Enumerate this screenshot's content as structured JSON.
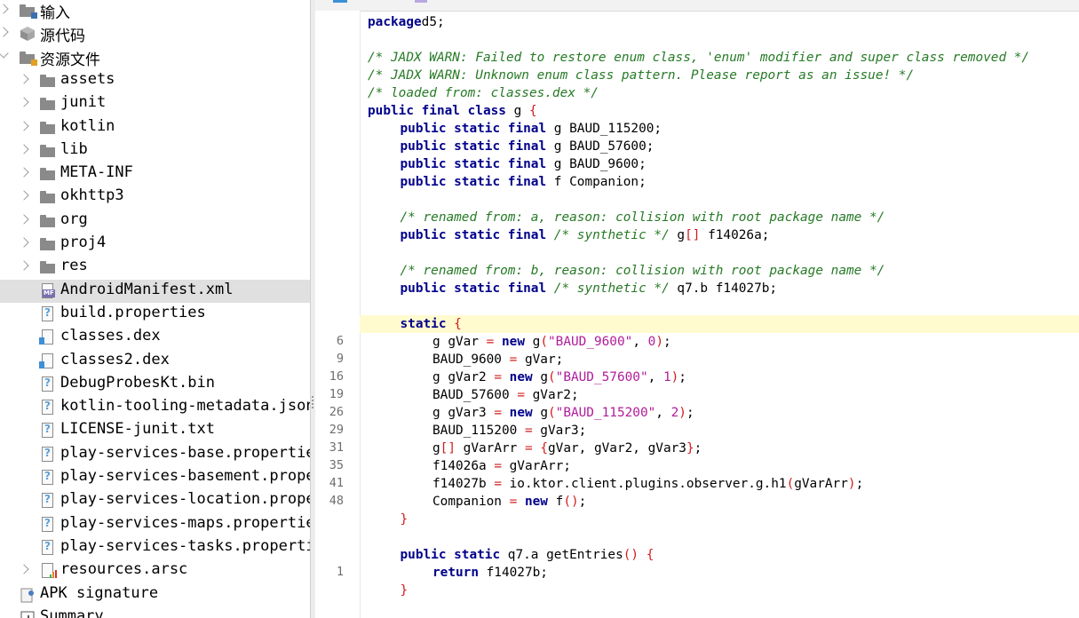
{
  "tree": {
    "items": [
      {
        "label": "输入",
        "icon": "input-icon",
        "chevron": "right",
        "indent": 0,
        "cjk": true
      },
      {
        "label": "源代码",
        "icon": "package-icon",
        "chevron": "right",
        "indent": 0,
        "cjk": true
      },
      {
        "label": "资源文件",
        "icon": "resources-folder-icon",
        "chevron": "down",
        "indent": 0,
        "cjk": true
      },
      {
        "label": "assets",
        "icon": "folder-icon",
        "chevron": "right",
        "indent": 1
      },
      {
        "label": "junit",
        "icon": "folder-icon",
        "chevron": "right",
        "indent": 1
      },
      {
        "label": "kotlin",
        "icon": "folder-icon",
        "chevron": "right",
        "indent": 1
      },
      {
        "label": "lib",
        "icon": "folder-icon",
        "chevron": "right",
        "indent": 1
      },
      {
        "label": "META-INF",
        "icon": "folder-icon",
        "chevron": "right",
        "indent": 1
      },
      {
        "label": "okhttp3",
        "icon": "folder-icon",
        "chevron": "right",
        "indent": 1
      },
      {
        "label": "org",
        "icon": "folder-icon",
        "chevron": "right",
        "indent": 1
      },
      {
        "label": "proj4",
        "icon": "folder-icon",
        "chevron": "right",
        "indent": 1
      },
      {
        "label": "res",
        "icon": "folder-icon",
        "chevron": "right",
        "indent": 1
      },
      {
        "label": "AndroidManifest.xml",
        "icon": "manifest-file-icon",
        "chevron": "",
        "indent": 1,
        "selected": true
      },
      {
        "label": "build.properties",
        "icon": "unknown-file-icon",
        "chevron": "",
        "indent": 1
      },
      {
        "label": "classes.dex",
        "icon": "dex-file-icon",
        "chevron": "",
        "indent": 1
      },
      {
        "label": "classes2.dex",
        "icon": "dex-file-icon",
        "chevron": "",
        "indent": 1
      },
      {
        "label": "DebugProbesKt.bin",
        "icon": "unknown-file-icon",
        "chevron": "",
        "indent": 1
      },
      {
        "label": "kotlin-tooling-metadata.json",
        "icon": "unknown-file-icon",
        "chevron": "",
        "indent": 1
      },
      {
        "label": "LICENSE-junit.txt",
        "icon": "unknown-file-icon",
        "chevron": "",
        "indent": 1
      },
      {
        "label": "play-services-base.properties",
        "icon": "unknown-file-icon",
        "chevron": "",
        "indent": 1
      },
      {
        "label": "play-services-basement.properties",
        "icon": "unknown-file-icon",
        "chevron": "",
        "indent": 1
      },
      {
        "label": "play-services-location.properties",
        "icon": "unknown-file-icon",
        "chevron": "",
        "indent": 1
      },
      {
        "label": "play-services-maps.properties",
        "icon": "unknown-file-icon",
        "chevron": "",
        "indent": 1
      },
      {
        "label": "play-services-tasks.properties",
        "icon": "unknown-file-icon",
        "chevron": "",
        "indent": 1
      },
      {
        "label": "resources.arsc",
        "icon": "arsc-file-icon",
        "chevron": "right",
        "indent": 1
      },
      {
        "label": "APK signature",
        "icon": "signature-icon",
        "chevron": "",
        "indent": 0
      },
      {
        "label": "Summary",
        "icon": "summary-icon",
        "chevron": "",
        "indent": 0
      }
    ]
  },
  "editor": {
    "highlight_line_index": 17,
    "lines": [
      {
        "ln": "",
        "ind": 0,
        "tokens": [
          [
            "kw",
            "package"
          ],
          [
            "",
            "d5;"
          ]
        ]
      },
      {
        "ln": "",
        "ind": 0,
        "tokens": []
      },
      {
        "ln": "",
        "ind": 0,
        "tokens": [
          [
            "cm",
            "/* JADX WARN: Failed to restore enum class, 'enum' modifier and super class removed */"
          ]
        ]
      },
      {
        "ln": "",
        "ind": 0,
        "tokens": [
          [
            "cm",
            "/* JADX WARN: Unknown enum class pattern. Please report as an issue! */"
          ]
        ]
      },
      {
        "ln": "",
        "ind": 0,
        "tokens": [
          [
            "cm",
            "/* loaded from: classes.dex */"
          ]
        ]
      },
      {
        "ln": "",
        "ind": 0,
        "tokens": [
          [
            "kw",
            "public final class"
          ],
          [
            "",
            " g "
          ],
          [
            "br",
            "{"
          ]
        ]
      },
      {
        "ln": "",
        "ind": 1,
        "tokens": [
          [
            "kw",
            "public static final"
          ],
          [
            "",
            " g BAUD_115200;"
          ]
        ]
      },
      {
        "ln": "",
        "ind": 1,
        "tokens": [
          [
            "kw",
            "public static final"
          ],
          [
            "",
            " g BAUD_57600;"
          ]
        ]
      },
      {
        "ln": "",
        "ind": 1,
        "tokens": [
          [
            "kw",
            "public static final"
          ],
          [
            "",
            " g BAUD_9600;"
          ]
        ]
      },
      {
        "ln": "",
        "ind": 1,
        "tokens": [
          [
            "kw",
            "public static final"
          ],
          [
            "",
            " f Companion;"
          ]
        ]
      },
      {
        "ln": "",
        "ind": 0,
        "tokens": []
      },
      {
        "ln": "",
        "ind": 1,
        "tokens": [
          [
            "cm",
            "/* renamed from: a, reason: collision with root package name */"
          ]
        ]
      },
      {
        "ln": "",
        "ind": 1,
        "tokens": [
          [
            "kw",
            "public static final"
          ],
          [
            "",
            " "
          ],
          [
            "cm",
            "/* synthetic */"
          ],
          [
            "",
            " g"
          ],
          [
            "br",
            "[]"
          ],
          [
            "",
            " f14026a;"
          ]
        ]
      },
      {
        "ln": "",
        "ind": 0,
        "tokens": []
      },
      {
        "ln": "",
        "ind": 1,
        "tokens": [
          [
            "cm",
            "/* renamed from: b, reason: collision with root package name */"
          ]
        ]
      },
      {
        "ln": "",
        "ind": 1,
        "tokens": [
          [
            "kw",
            "public static final"
          ],
          [
            "",
            " "
          ],
          [
            "cm",
            "/* synthetic */"
          ],
          [
            "",
            " q7.b f14027b;"
          ]
        ]
      },
      {
        "ln": "",
        "ind": 0,
        "tokens": []
      },
      {
        "ln": "",
        "ind": 1,
        "tokens": [
          [
            "kw",
            "static"
          ],
          [
            "",
            " "
          ],
          [
            "br",
            "{"
          ]
        ]
      },
      {
        "ln": "6",
        "ind": 2,
        "tokens": [
          [
            "",
            "g gVar "
          ],
          [
            "br",
            "="
          ],
          [
            "",
            " "
          ],
          [
            "kw",
            "new"
          ],
          [
            "",
            " g"
          ],
          [
            "br",
            "("
          ],
          [
            "str",
            "\"BAUD_9600\""
          ],
          [
            "",
            ", "
          ],
          [
            "num",
            "0"
          ],
          [
            "br",
            ")"
          ],
          [
            "",
            ";"
          ]
        ]
      },
      {
        "ln": "9",
        "ind": 2,
        "tokens": [
          [
            "",
            "BAUD_9600 "
          ],
          [
            "br",
            "="
          ],
          [
            "",
            " gVar;"
          ]
        ]
      },
      {
        "ln": "16",
        "ind": 2,
        "tokens": [
          [
            "",
            "g gVar2 "
          ],
          [
            "br",
            "="
          ],
          [
            "",
            " "
          ],
          [
            "kw",
            "new"
          ],
          [
            "",
            " g"
          ],
          [
            "br",
            "("
          ],
          [
            "str",
            "\"BAUD_57600\""
          ],
          [
            "",
            ", "
          ],
          [
            "num",
            "1"
          ],
          [
            "br",
            ")"
          ],
          [
            "",
            ";"
          ]
        ]
      },
      {
        "ln": "19",
        "ind": 2,
        "tokens": [
          [
            "",
            "BAUD_57600 "
          ],
          [
            "br",
            "="
          ],
          [
            "",
            " gVar2;"
          ]
        ]
      },
      {
        "ln": "26",
        "ind": 2,
        "tokens": [
          [
            "",
            "g gVar3 "
          ],
          [
            "br",
            "="
          ],
          [
            "",
            " "
          ],
          [
            "kw",
            "new"
          ],
          [
            "",
            " g"
          ],
          [
            "br",
            "("
          ],
          [
            "str",
            "\"BAUD_115200\""
          ],
          [
            "",
            ", "
          ],
          [
            "num",
            "2"
          ],
          [
            "br",
            ")"
          ],
          [
            "",
            ";"
          ]
        ]
      },
      {
        "ln": "29",
        "ind": 2,
        "tokens": [
          [
            "",
            "BAUD_115200 "
          ],
          [
            "br",
            "="
          ],
          [
            "",
            " gVar3;"
          ]
        ]
      },
      {
        "ln": "31",
        "ind": 2,
        "tokens": [
          [
            "",
            "g"
          ],
          [
            "br",
            "[]"
          ],
          [
            "",
            " gVarArr "
          ],
          [
            "br",
            "="
          ],
          [
            "",
            " "
          ],
          [
            "br",
            "{"
          ],
          [
            "",
            "gVar, gVar2, gVar3"
          ],
          [
            "br",
            "}"
          ],
          [
            "",
            ";"
          ]
        ]
      },
      {
        "ln": "35",
        "ind": 2,
        "tokens": [
          [
            "",
            "f14026a "
          ],
          [
            "br",
            "="
          ],
          [
            "",
            " gVarArr;"
          ]
        ]
      },
      {
        "ln": "41",
        "ind": 2,
        "tokens": [
          [
            "",
            "f14027b "
          ],
          [
            "br",
            "="
          ],
          [
            "",
            " io.ktor.client.plugins.observer.g.h1"
          ],
          [
            "br",
            "("
          ],
          [
            "",
            "gVarArr"
          ],
          [
            "br",
            ")"
          ],
          [
            "",
            ";"
          ]
        ]
      },
      {
        "ln": "48",
        "ind": 2,
        "tokens": [
          [
            "",
            "Companion "
          ],
          [
            "br",
            "="
          ],
          [
            "",
            " "
          ],
          [
            "kw",
            "new"
          ],
          [
            "",
            " f"
          ],
          [
            "br",
            "()"
          ],
          [
            "",
            ";"
          ]
        ]
      },
      {
        "ln": "",
        "ind": 1,
        "tokens": [
          [
            "br",
            "}"
          ]
        ]
      },
      {
        "ln": "",
        "ind": 0,
        "tokens": []
      },
      {
        "ln": "",
        "ind": 1,
        "tokens": [
          [
            "kw",
            "public static"
          ],
          [
            "",
            " q7.a getEntries"
          ],
          [
            "br",
            "()"
          ],
          [
            "",
            " "
          ],
          [
            "br",
            "{"
          ]
        ]
      },
      {
        "ln": "1",
        "ind": 2,
        "tokens": [
          [
            "kw",
            "return"
          ],
          [
            "",
            " f14027b;"
          ]
        ]
      },
      {
        "ln": "",
        "ind": 1,
        "tokens": [
          [
            "br",
            "}"
          ]
        ]
      }
    ]
  },
  "colors": {
    "keyword": "#00008b",
    "comment": "#267a26",
    "string": "#b11c9b",
    "brace": "#d21c1c",
    "highlight_line": "#fffbcf",
    "selected_row": "#e0e0e0"
  }
}
